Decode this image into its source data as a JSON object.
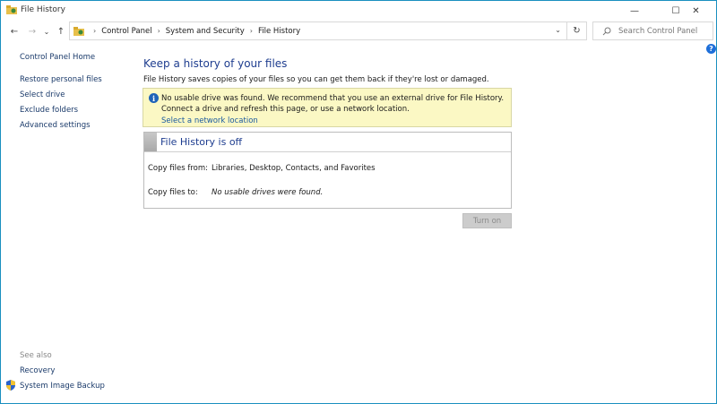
{
  "window": {
    "title": "File History",
    "minimize_glyph": "—",
    "maximize_glyph": "☐",
    "close_glyph": "✕"
  },
  "nav": {
    "back_glyph": "←",
    "forward_glyph": "→",
    "recent_glyph": "⌄",
    "up_glyph": "↑",
    "breadcrumb": [
      "Control Panel",
      "System and Security",
      "File History"
    ],
    "separator": "›",
    "dropdown_glyph": "⌄",
    "refresh_glyph": "↻",
    "search_placeholder": "Search Control Panel",
    "search_glyph": "⚲"
  },
  "help_glyph": "?",
  "sidebar": {
    "home": "Control Panel Home",
    "items": [
      "Restore personal files",
      "Select drive",
      "Exclude folders",
      "Advanced settings"
    ],
    "see_also_label": "See also",
    "see_also_items": [
      "Recovery",
      "System Image Backup"
    ]
  },
  "main": {
    "title": "Keep a history of your files",
    "description": "File History saves copies of your files so you can get them back if they're lost or damaged.",
    "warning": {
      "icon_glyph": "i",
      "message": "No usable drive was found. We recommend that you use an external drive for File History. Connect a drive and refresh this page, or use a network location.",
      "link": "Select a network location"
    },
    "status": {
      "title": "File History is off",
      "copy_from_label": "Copy files from:",
      "copy_from_value": "Libraries, Desktop, Contacts, and Favorites",
      "copy_to_label": "Copy files to:",
      "copy_to_value": "No usable drives were found."
    },
    "turn_on_label": "Turn on"
  },
  "colors": {
    "accent": "#1e3d8f",
    "link": "#1a5aa0",
    "warning_bg": "#fbf8c4",
    "window_border": "#1a8fbf"
  }
}
